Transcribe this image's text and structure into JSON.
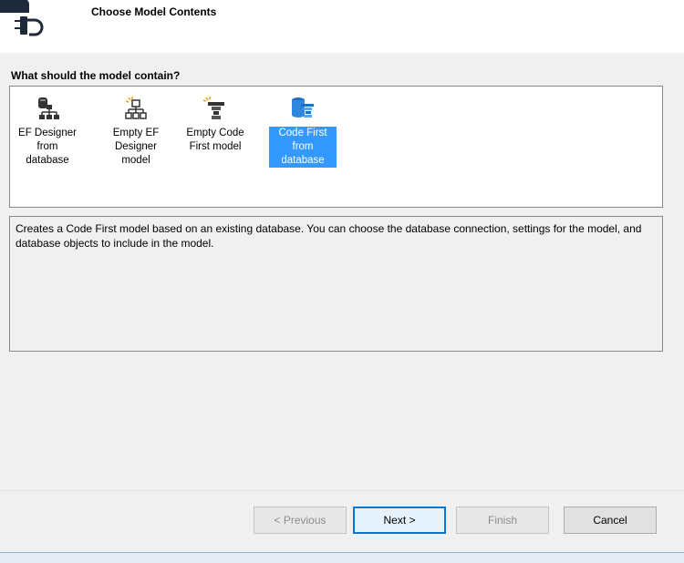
{
  "header": {
    "title": "Choose Model Contents",
    "logo_icon": "plug-database-icon"
  },
  "section_label": "What should the model contain?",
  "options": [
    {
      "label_lines": [
        "EF Designer",
        "from",
        "database"
      ],
      "icon": "database-hierarchy-icon",
      "selected": false
    },
    {
      "label_lines": [
        "Empty EF",
        "Designer",
        "model"
      ],
      "icon": "empty-hierarchy-icon",
      "selected": false
    },
    {
      "label_lines": [
        "Empty Code",
        "First model"
      ],
      "icon": "empty-code-icon",
      "selected": false
    },
    {
      "label_lines": [
        "Code First",
        "from",
        "database"
      ],
      "icon": "code-first-database-icon",
      "selected": true
    }
  ],
  "description": "Creates a Code First model based on an existing database. You can choose the database connection, settings for the model, and database objects to include in the model.",
  "buttons": {
    "previous": "< Previous",
    "next": "Next >",
    "finish": "Finish",
    "cancel": "Cancel"
  },
  "colors": {
    "selection": "#3399ff",
    "default_button_border": "#0078d7"
  }
}
